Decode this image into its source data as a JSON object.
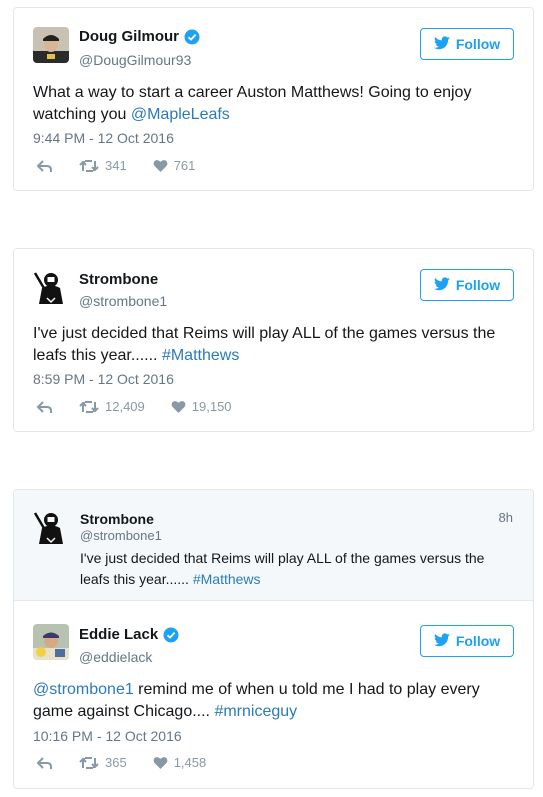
{
  "tweets": [
    {
      "name": "Doug Gilmour",
      "handle": "@DougGilmour93",
      "verified": true,
      "follow_label": "Follow",
      "text_parts": [
        "What a way to start a career Auston Matthews! Going to enjoy watching you ",
        "@MapleLeafs"
      ],
      "timestamp": "9:44 PM - 12 Oct 2016",
      "retweets": "341",
      "likes": "761",
      "avatar": "photo"
    },
    {
      "name": "Strombone",
      "handle": "@strombone1",
      "verified": false,
      "follow_label": "Follow",
      "text_parts": [
        "I've just decided that Reims will play ALL of the games versus the leafs this year...... ",
        "#Matthews"
      ],
      "timestamp": "8:59 PM - 12 Oct 2016",
      "retweets": "12,409",
      "likes": "19,150",
      "avatar": "goalie-icon"
    },
    {
      "quoted": {
        "name": "Strombone",
        "handle": "@strombone1",
        "age": "8h",
        "text_parts": [
          "I've just decided that Reims will play ALL of the games versus the leafs this year...... ",
          "#Matthews"
        ],
        "avatar": "goalie-icon"
      },
      "name": "Eddie Lack",
      "handle": "@eddielack",
      "verified": true,
      "follow_label": "Follow",
      "text_parts": [
        "@strombone1",
        " remind me of when u told me I had to play every game against Chicago.... ",
        "#mrniceguy"
      ],
      "timestamp": "10:16 PM - 12 Oct 2016",
      "retweets": "365",
      "likes": "1,458",
      "avatar": "photo"
    }
  ],
  "icons": {
    "reply": "reply-icon",
    "retweet": "retweet-icon",
    "like": "heart-icon",
    "verified": "verified-badge-icon",
    "follow": "twitter-bird-icon"
  },
  "colors": {
    "brand": "#1da1f2",
    "link": "#2b7bb9",
    "muted": "#657786",
    "border": "#e1e8ed"
  }
}
